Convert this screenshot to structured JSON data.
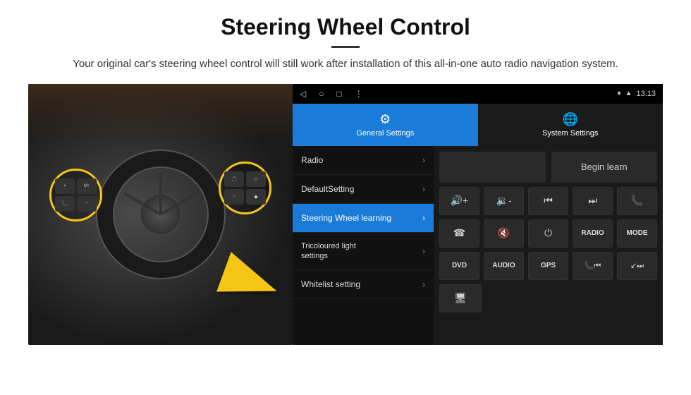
{
  "page": {
    "title": "Steering Wheel Control",
    "subtitle": "Your original car's steering wheel control will still work after installation of this all-in-one auto radio navigation system."
  },
  "android": {
    "topbar": {
      "nav_back": "◁",
      "nav_home": "○",
      "nav_square": "□",
      "nav_menu": "⋮",
      "status_gps": "♦",
      "status_signal": "▲",
      "time": "13:13"
    },
    "tabs": [
      {
        "label": "General Settings",
        "icon": "⚙",
        "active": true
      },
      {
        "label": "System Settings",
        "icon": "🌐",
        "active": false
      }
    ],
    "menu_items": [
      {
        "label": "Radio",
        "active": false
      },
      {
        "label": "DefaultSetting",
        "active": false
      },
      {
        "label": "Steering Wheel learning",
        "active": true
      },
      {
        "label": "Tricoloured light settings",
        "active": false,
        "two_line": true
      },
      {
        "label": "Whitelist setting",
        "active": false
      }
    ],
    "controls": {
      "begin_learn_label": "Begin learn",
      "row1": [
        "🔊+",
        "🔊-",
        "⏮",
        "⏭",
        "📞"
      ],
      "row2": [
        "☎",
        "🔇",
        "⏻",
        "RADIO",
        "MODE"
      ],
      "row3": [
        "DVD",
        "AUDIO",
        "GPS",
        "📞⏮",
        "↙⏭"
      ],
      "row4": [
        "🖥"
      ]
    }
  }
}
